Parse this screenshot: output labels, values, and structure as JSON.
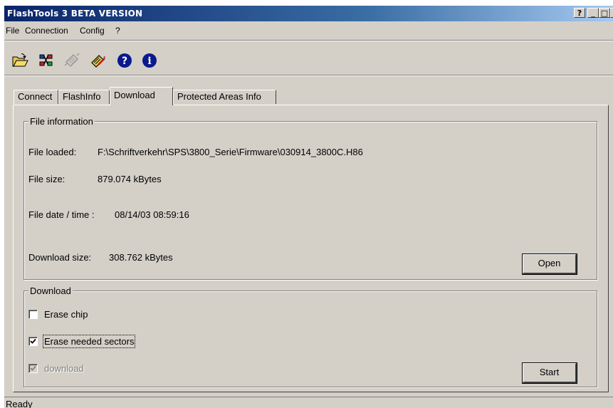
{
  "window": {
    "title": "FlashTools 3  BETA VERSION",
    "help_glyph": "?",
    "min_glyph": "_",
    "max_glyph": "□",
    "close_glyph": "×"
  },
  "menu": {
    "items": [
      "File",
      "Connection",
      "Config",
      "?"
    ]
  },
  "toolbar": {
    "icons": [
      "open-folder-icon",
      "connect-icon",
      "flash-icon",
      "flash-edit-icon",
      "help-icon",
      "info-icon"
    ]
  },
  "tabs": [
    {
      "label": "Connect"
    },
    {
      "label": "FlashInfo"
    },
    {
      "label": "Download",
      "active": true
    },
    {
      "label": "Protected Areas Info"
    }
  ],
  "file_info": {
    "legend": "File information",
    "loaded_label": "File loaded:",
    "loaded_value": "F:\\Schriftverkehr\\SPS\\3800_Serie\\Firmware\\030914_3800C.H86",
    "size_label": "File size:",
    "size_value": "879.074 kBytes",
    "date_label": "File date / time :",
    "date_value": "08/14/03 08:59:16",
    "download_size_label": "Download size:",
    "download_size_value": "308.762 kBytes",
    "open_button": "Open"
  },
  "download": {
    "legend": "Download",
    "erase_chip": {
      "label": "Erase chip",
      "checked": false
    },
    "erase_needed": {
      "label": "Erase needed sectors",
      "checked": true
    },
    "download_opt": {
      "label": "download",
      "checked": true,
      "disabled": true
    },
    "start_button": "Start"
  },
  "status": {
    "text": "Ready"
  }
}
